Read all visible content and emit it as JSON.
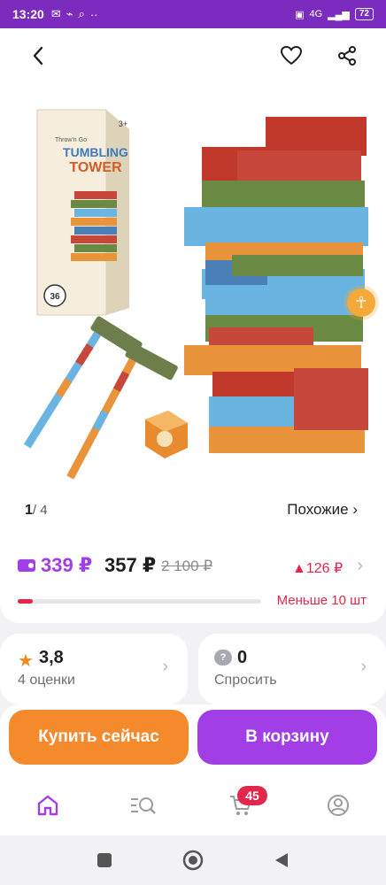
{
  "status_bar": {
    "time": "13:20",
    "network": "4G",
    "battery": "72"
  },
  "header": {
    "icons": [
      "back-arrow-icon",
      "heart-icon",
      "share-icon"
    ]
  },
  "gallery": {
    "current": "1",
    "total": "/ 4",
    "similar_label": "Похожие ›",
    "box_text": {
      "brand_line": "Throw'n Go",
      "title_top": "TUMBLING",
      "title_bottom": "TOWER",
      "badge": "36",
      "age": "3+"
    }
  },
  "price": {
    "wallet_price": "339 ₽",
    "price": "357 ₽",
    "old_price": "2 100 ₽",
    "drop": "▲126 ₽",
    "stock_label": "Меньше 10 шт",
    "stock_fraction": 0.06,
    "colors": {
      "wallet": "#a23ee6",
      "alert": "#e3264b"
    }
  },
  "rating": {
    "value": "3,8",
    "count_label": "4 оценки"
  },
  "questions": {
    "count": "0",
    "label": "Спросить"
  },
  "actions": {
    "buy_now": "Купить сейчас",
    "add_to_cart": "В корзину",
    "colors": {
      "buy": "#f58a2c",
      "cart": "#a23ee6"
    }
  },
  "bottom_nav": {
    "cart_badge": "45",
    "items": [
      "home-icon",
      "catalog-search-icon",
      "cart-icon",
      "profile-icon"
    ]
  }
}
